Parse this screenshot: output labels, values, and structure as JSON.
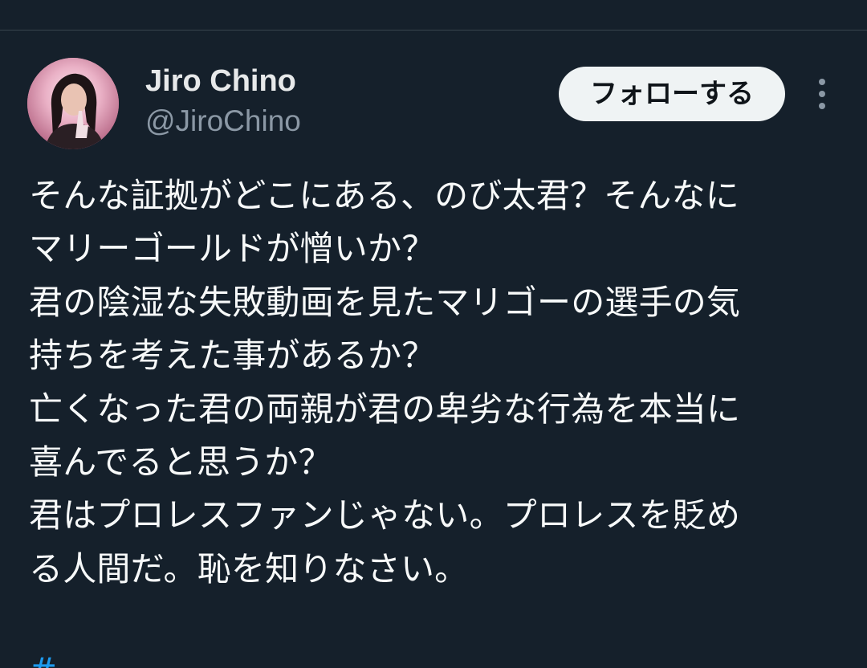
{
  "author": {
    "display_name": "Jiro Chino",
    "handle": "@JiroChino"
  },
  "follow_button": {
    "label": "フォローする"
  },
  "tweet": {
    "lines": [
      "そんな証拠がどこにある、のび太君？そんなに",
      "マリーゴールドが憎いか？",
      "君の陰湿な失敗動画を見たマリゴーの選手の気",
      "持ちを考えた事があるか？",
      "亡くなった君の両親が君の卑劣な行為を本当に",
      "喜んでると思うか？",
      "君はプロレスファンじゃない。プロレスを貶め",
      "る人間だ。恥を知りなさい。"
    ],
    "hashtag_partial": "#..."
  },
  "icons": {
    "more": "more-vertical-icon",
    "avatar": "avatar"
  },
  "colors": {
    "background": "#15202b",
    "text": "#f7f9f9",
    "secondary_text": "#8b98a5",
    "link": "#1d9bf0",
    "button_bg": "#eff3f4"
  }
}
